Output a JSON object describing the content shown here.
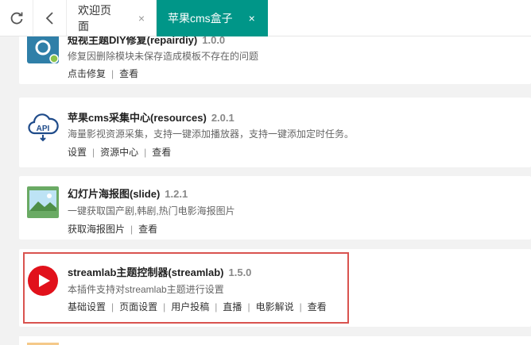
{
  "tabs": {
    "home": {
      "label": "欢迎页面",
      "close": "×"
    },
    "active": {
      "label": "苹果cms盒子",
      "close": "×"
    }
  },
  "plugins": [
    {
      "title": "短视主题DIY修复(repairdiy)",
      "version": "1.0.0",
      "desc": "修复因删除模块未保存造成模板不存在的问题",
      "links": [
        "点击修复",
        "查看"
      ],
      "icon_color": "#2f7fa8"
    },
    {
      "title": "苹果cms采集中心(resources)",
      "version": "2.0.1",
      "desc": "海量影视资源采集，支持一键添加播放器，支持一键添加定时任务。",
      "links": [
        "设置",
        "资源中心",
        "查看"
      ],
      "icon_color": "#1f4b8a"
    },
    {
      "title": "幻灯片海报图(slide)",
      "version": "1.2.1",
      "desc": "一键获取国产剧,韩剧,热门电影海报图片",
      "links": [
        "获取海报图片",
        "查看"
      ],
      "icon_color": "#5a9e5a"
    },
    {
      "title": "streamlab主题控制器(streamlab)",
      "version": "1.5.0",
      "desc": "本插件支持对streamlab主题进行设置",
      "links": [
        "基础设置",
        "页面设置",
        "用户投稿",
        "直播",
        "电影解说",
        "查看"
      ],
      "icon_color": "#e1111b"
    }
  ],
  "colors": {
    "accent": "#009688",
    "highlight": "#d9534f"
  }
}
